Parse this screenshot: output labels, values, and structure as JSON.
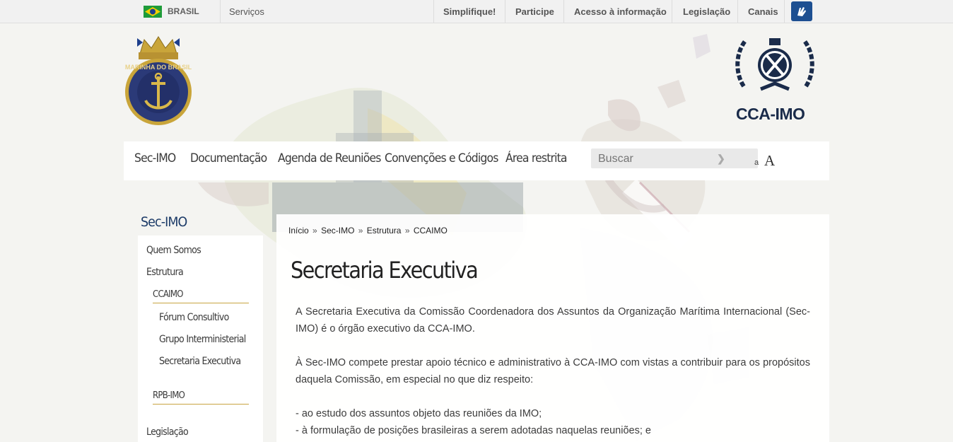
{
  "govbar": {
    "country": "BRASIL",
    "services": "Serviços",
    "links": [
      "Simplifique!",
      "Participe",
      "Acesso à informação",
      "Legislação",
      "Canais"
    ]
  },
  "header": {
    "navy_logo_alt": "MARINHA DO BRASIL",
    "imo_logo_text": "CCA-IMO"
  },
  "nav": {
    "items": [
      "Sec-IMO",
      "Documentação",
      "Agenda de Reuniões",
      "Convenções e Códigos",
      "Área restrita"
    ],
    "search_placeholder": "Buscar",
    "font_small": "a",
    "font_big": "A"
  },
  "sidebar": {
    "title": "Sec-IMO",
    "items": [
      "Quem Somos",
      "Estrutura",
      "CCAIMO",
      "Fórum Consultivo",
      "Grupo Interministerial",
      "Secretaria Executiva",
      "RPB-IMO",
      "Legislação"
    ]
  },
  "breadcrumb": [
    "Início",
    "Sec-IMO",
    "Estrutura",
    "CCAIMO"
  ],
  "breadcrumb_sep": "»",
  "content": {
    "title": "Secretaria Executiva",
    "p1": "A Secretaria Executiva da Comissão Coordenadora dos Assuntos da Organização Marítima Internacional (Sec-IMO) é o órgão executivo da CCA-IMO.",
    "p2": "À Sec-IMO compete prestar apoio técnico e administrativo à CCA-IMO com vistas a contribuir para os propósitos daquela Comissão, em especial no que diz respeito:",
    "li1": "- ao estudo dos assuntos objeto das reuniões da IMO;",
    "li2": "- à formulação de posições brasileiras a serem adotadas naquelas reuniões; e"
  },
  "colors": {
    "nav_bg": "#ffffff",
    "title_blue": "#1c3b68",
    "gold_line": "#c8a442",
    "access_blue": "#1d4f91"
  }
}
